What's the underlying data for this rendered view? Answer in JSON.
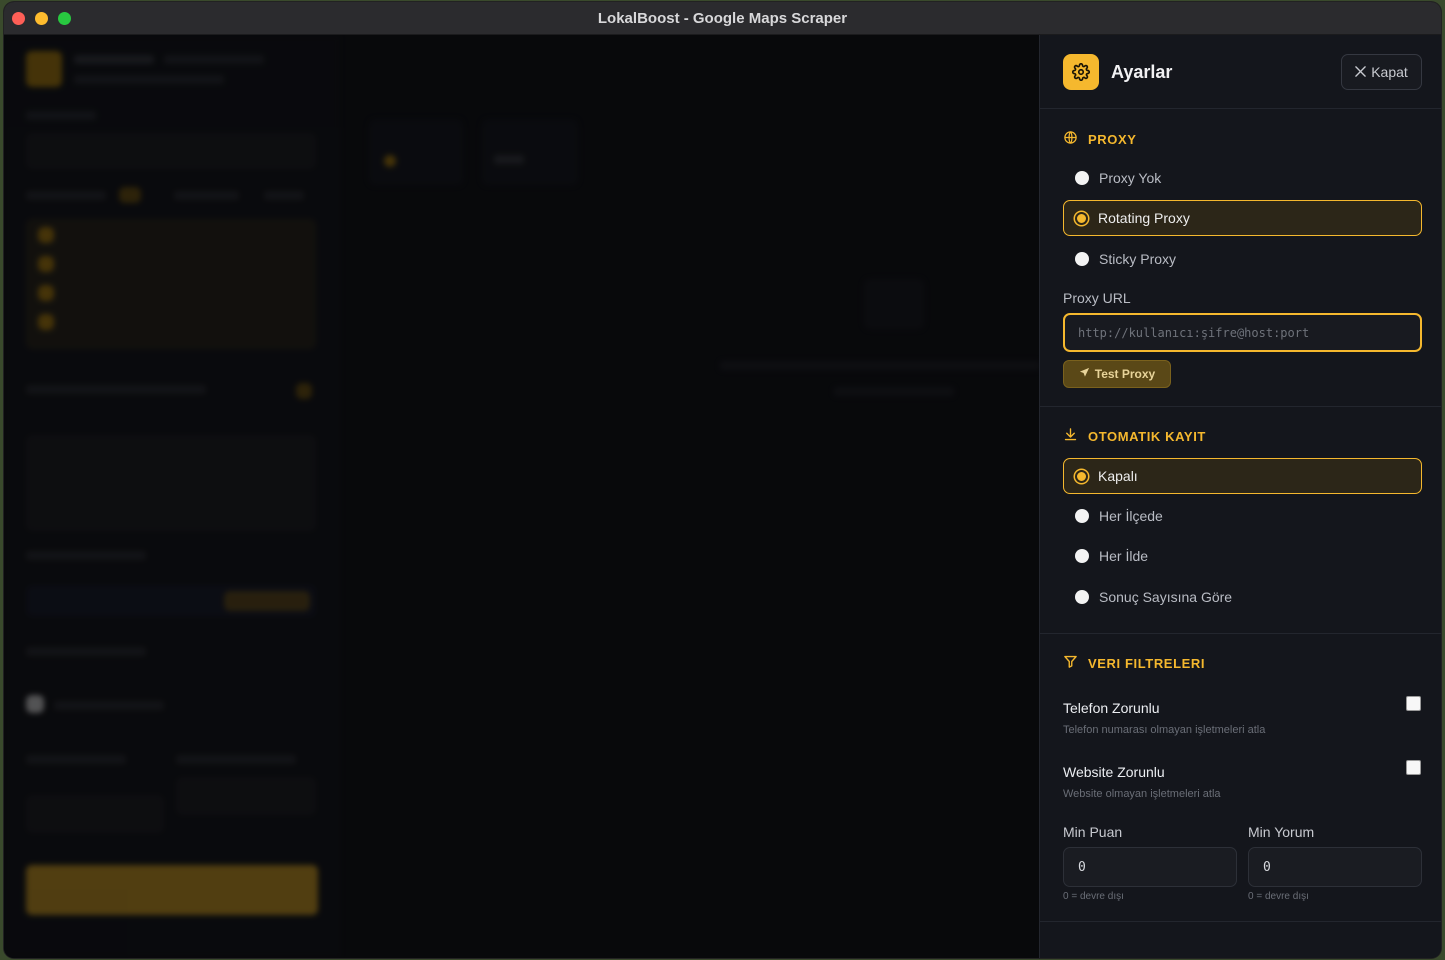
{
  "window": {
    "title": "LokalBoost - Google Maps Scraper"
  },
  "panel": {
    "title": "Ayarlar",
    "close_label": "Kapat",
    "proxy": {
      "section_title": "PROXY",
      "options": [
        "Proxy Yok",
        "Rotating Proxy",
        "Sticky Proxy"
      ],
      "selected": "Rotating Proxy",
      "url_label": "Proxy URL",
      "url_placeholder": "http://kullanıcı:şifre@host:port",
      "url_value": "",
      "test_label": "Test Proxy"
    },
    "autosave": {
      "section_title": "OTOMATIK KAYIT",
      "options": [
        "Kapalı",
        "Her İlçede",
        "Her İlde",
        "Sonuç Sayısına Göre"
      ],
      "selected": "Kapalı"
    },
    "filters": {
      "section_title": "VERI FILTRELERI",
      "phone_title": "Telefon Zorunlu",
      "phone_desc": "Telefon numarası olmayan işletmeleri atla",
      "phone_checked": false,
      "website_title": "Website Zorunlu",
      "website_desc": "Website olmayan işletmeleri atla",
      "website_checked": false,
      "min_rating_label": "Min Puan",
      "min_rating_value": "0",
      "min_rating_hint": "0 = devre dışı",
      "min_reviews_label": "Min Yorum",
      "min_reviews_value": "0",
      "min_reviews_hint": "0 = devre dışı"
    }
  },
  "colors": {
    "accent": "#f5b82e",
    "panel_bg": "#14161c",
    "selected_bg": "#2c2618"
  },
  "icons": [
    "gear-icon",
    "close-icon",
    "globe-icon",
    "download-icon",
    "filter-icon",
    "send-icon"
  ]
}
